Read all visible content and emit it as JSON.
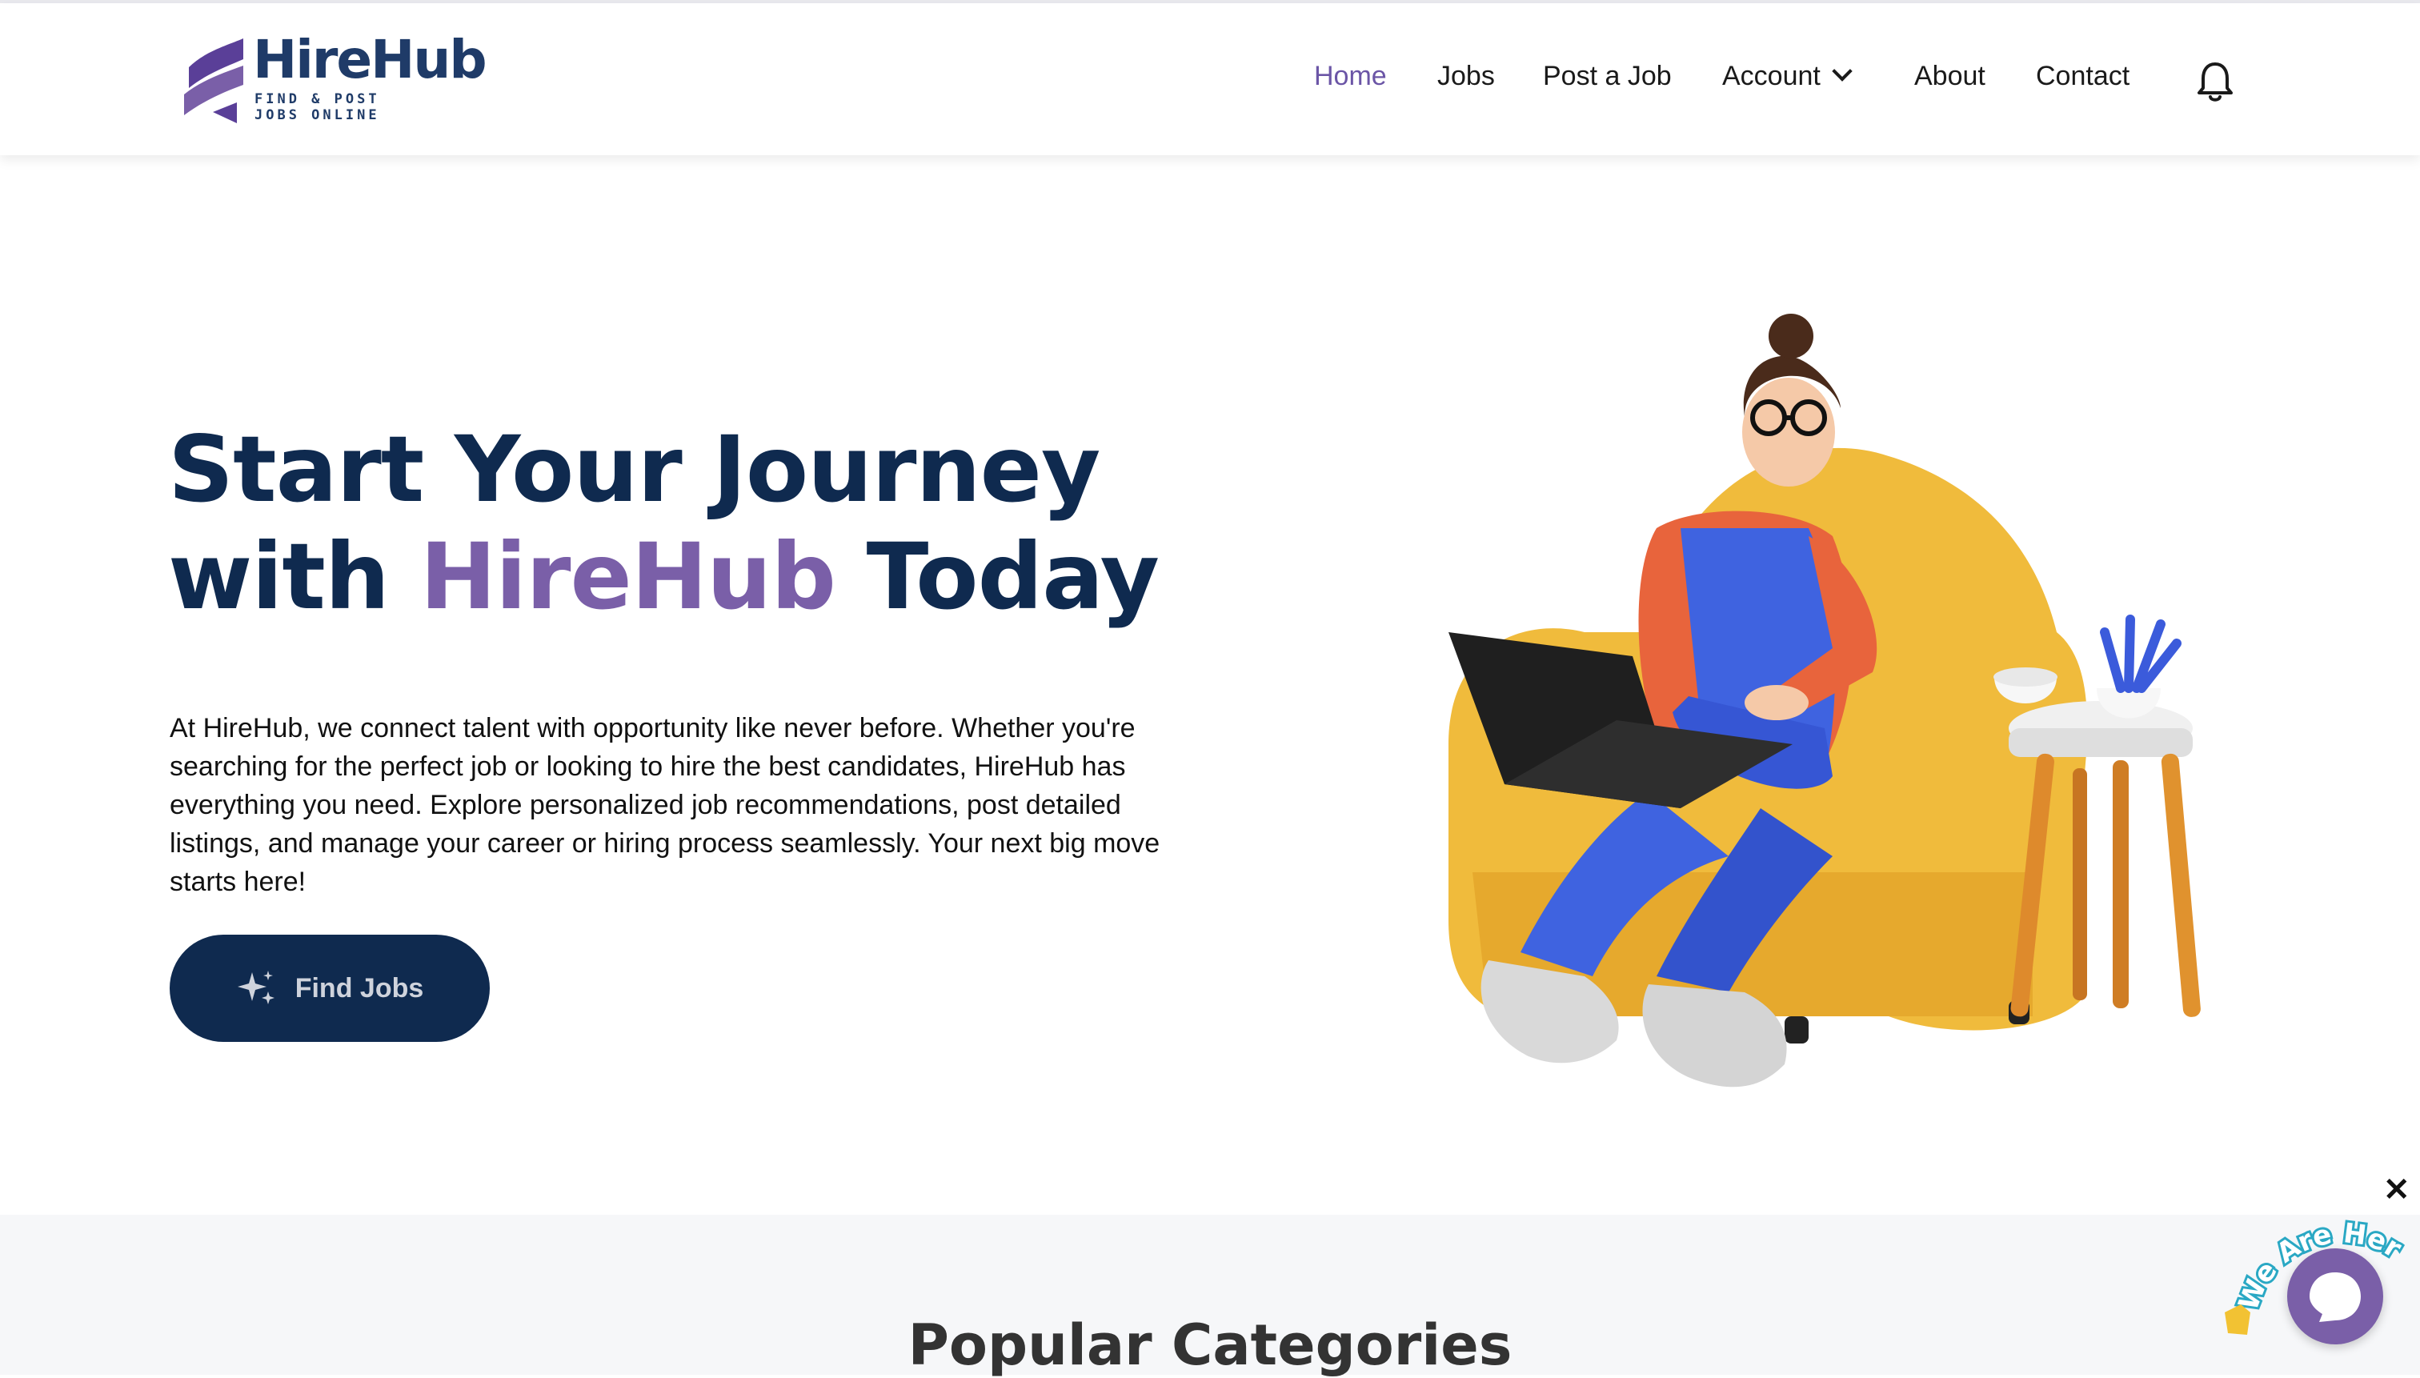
{
  "header": {
    "logo_name": "HireHub",
    "logo_tagline_1": "FIND & POST",
    "logo_tagline_2": "JOBS ONLINE",
    "nav": [
      {
        "label": "Home",
        "active": true
      },
      {
        "label": "Jobs"
      },
      {
        "label": "Post a Job"
      },
      {
        "label": "Account"
      },
      {
        "label": "About"
      },
      {
        "label": "Contact"
      }
    ],
    "bell_icon": "bell-icon"
  },
  "hero": {
    "title_line1": "Start Your Journey",
    "title_with": "with",
    "title_brand": "HireHub",
    "title_today": "Today",
    "description": "At HireHub, we connect talent with opportunity like never before. Whether you're searching for the perfect job or looking to hire the best candidates, HireHub has everything you need. Explore personalized job recommendations, post detailed listings, and manage your career or hiring process seamlessly. Your next big move starts here!",
    "cta_label": "Find Jobs",
    "cta_icon": "sparkle-icon"
  },
  "categories": {
    "title": "Popular Categories"
  },
  "chat": {
    "badge_text": "We Are Here!",
    "close_symbol": "✕",
    "icon": "chat-bubble-icon"
  },
  "colors": {
    "navy": "#0f2a4f",
    "purple": "#7a5fa8",
    "nav_active": "#6b55a6"
  }
}
